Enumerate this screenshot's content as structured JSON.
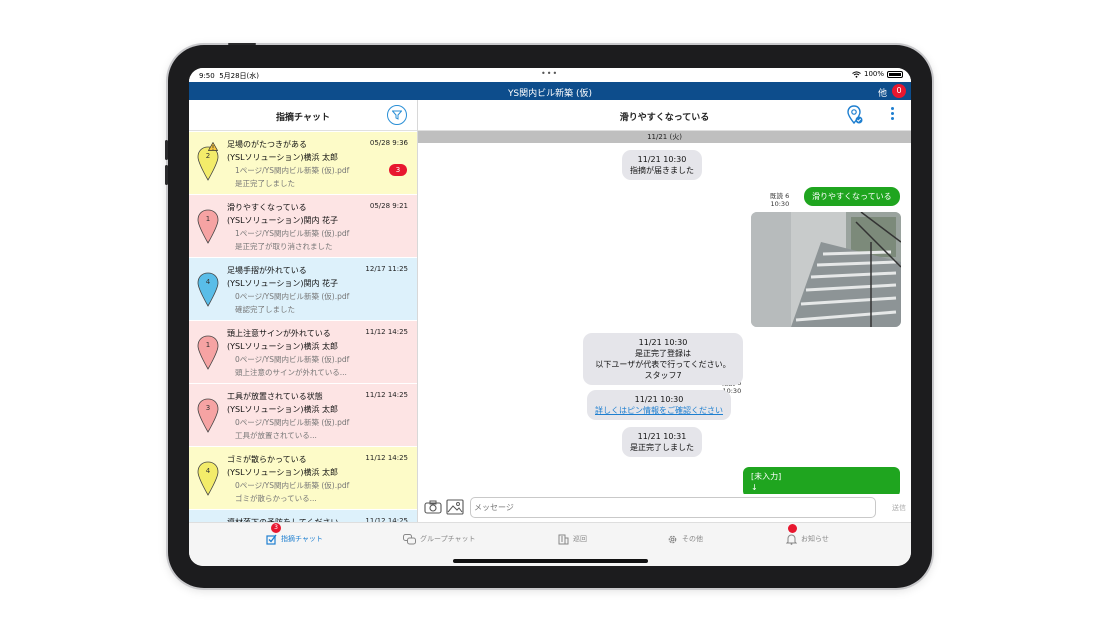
{
  "status_bar": {
    "time": "9:50",
    "date": "5月28日(水)",
    "battery": "100%"
  },
  "app_bar": {
    "title": "YS関内ビル新築 (仮)",
    "other_label": "他",
    "other_badge": "0"
  },
  "left": {
    "title": "指摘チャット",
    "items": [
      {
        "title": "足場のがたつきがある",
        "user": "(YSLソリューション)横浜 太郎",
        "file": "1ページ/YS関内ビル新築 (仮).pdf",
        "status": "是正完了しました",
        "date": "05/28 9:36",
        "pin_num": "2",
        "badge": "3",
        "bg": "#fdfbc8",
        "pin_color": "#f3ec6a"
      },
      {
        "title": "滑りやすくなっている",
        "user": "(YSLソリューション)関内 花子",
        "file": "1ページ/YS関内ビル新築 (仮).pdf",
        "status": "是正完了が取り消されました",
        "date": "05/28 9:21",
        "pin_num": "1",
        "bg": "#fde4e4",
        "pin_color": "#f6a3a3"
      },
      {
        "title": "足場手摺が外れている",
        "user": "(YSLソリューション)関内 花子",
        "file": "0ページ/YS関内ビル新築 (仮).pdf",
        "status": "確認完了しました",
        "date": "12/17 11:25",
        "pin_num": "4",
        "bg": "#ddf1fb",
        "pin_color": "#59bde8"
      },
      {
        "title": "頭上注意サインが外れている",
        "user": "(YSLソリューション)横浜 太郎",
        "file": "0ページ/YS関内ビル新築 (仮).pdf",
        "status": "頭上注意のサインが外れている...",
        "date": "11/12 14:25",
        "pin_num": "1",
        "bg": "#fde4e4",
        "pin_color": "#f6a3a3"
      },
      {
        "title": "工具が放置されている状態",
        "user": "(YSLソリューション)横浜 太郎",
        "file": "0ページ/YS関内ビル新築 (仮).pdf",
        "status": "工具が放置されている...",
        "date": "11/12 14:25",
        "pin_num": "3",
        "bg": "#fde4e4",
        "pin_color": "#f6a3a3"
      },
      {
        "title": "ゴミが散らかっている",
        "user": "(YSLソリューション)横浜 太郎",
        "file": "0ページ/YS関内ビル新築 (仮).pdf",
        "status": "ゴミが散らかっている...",
        "date": "11/12 14:25",
        "pin_num": "4",
        "bg": "#fdfbc8",
        "pin_color": "#f3ec6a"
      },
      {
        "title": "資材落下の予防をしてください",
        "user": "",
        "file": "",
        "status": "",
        "date": "11/12 14:25",
        "pin_num": "",
        "bg": "#ddf1fb",
        "pin_color": "#59bde8"
      }
    ]
  },
  "right": {
    "title": "滑りやすくなっている",
    "date_sep": "11/21 (火)",
    "messages": {
      "m1": {
        "time": "11/21 10:30",
        "text": "指摘が届きました"
      },
      "m2": {
        "read": "既読 6",
        "time": "10:30",
        "text": "滑りやすくなっている"
      },
      "m3": {
        "read": "既読 6",
        "time": "10:30"
      },
      "m4": {
        "time": "11/21 10:30",
        "line1": "是正完了登録は",
        "line2": "以下ユーザが代表で行ってください。",
        "line3": "スタッフ7"
      },
      "m5": {
        "time": "11/21 10:30",
        "link": "詳しくはピン情報をご確認ください"
      },
      "m6": {
        "time": "11/21 10:31",
        "text": "是正完了しました"
      },
      "m7": {
        "line1": "[未入力]",
        "line2": "↓"
      }
    },
    "input_placeholder": "メッセージ",
    "send_label": "送信"
  },
  "tabs": [
    {
      "label": "指摘チャット",
      "badge": "3"
    },
    {
      "label": "グループチャット"
    },
    {
      "label": "巡回"
    },
    {
      "label": "その他"
    },
    {
      "label": "お知らせ"
    }
  ]
}
